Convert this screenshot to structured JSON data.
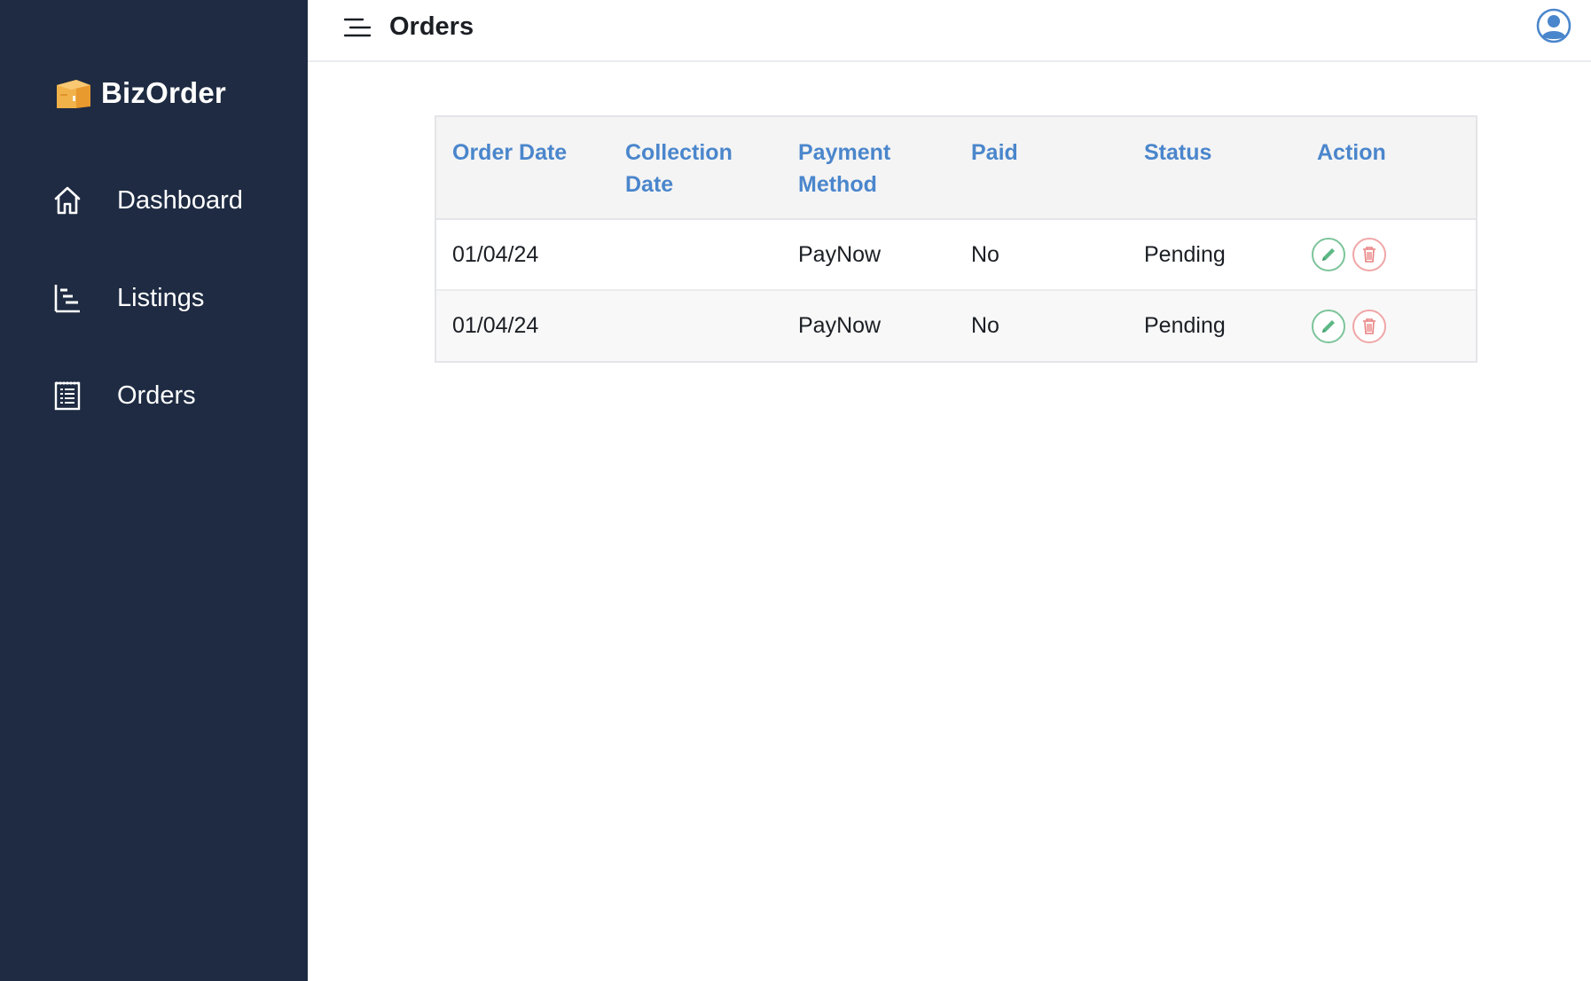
{
  "brand": {
    "name": "BizOrder"
  },
  "sidebar": {
    "items": [
      {
        "label": "Dashboard",
        "icon": "home-icon"
      },
      {
        "label": "Listings",
        "icon": "listings-icon"
      },
      {
        "label": "Orders",
        "icon": "orders-icon"
      }
    ]
  },
  "header": {
    "title": "Orders",
    "menu_icon": "menu-icon",
    "user_icon": "user-avatar-icon"
  },
  "table": {
    "columns": [
      "Order Date",
      "Collection Date",
      "Payment Method",
      "Paid",
      "Status",
      "Action"
    ],
    "rows": [
      {
        "order_date": "01/04/24",
        "collection_date": "",
        "payment_method": "PayNow",
        "paid": "No",
        "status": "Pending"
      },
      {
        "order_date": "01/04/24",
        "collection_date": "",
        "payment_method": "PayNow",
        "paid": "No",
        "status": "Pending"
      }
    ]
  },
  "colors": {
    "sidebar_bg": "#1e2b42",
    "header_text": "#4a86cc",
    "edit": "#5cb885",
    "delete": "#e98080",
    "brand_accent": "#f5b041"
  }
}
